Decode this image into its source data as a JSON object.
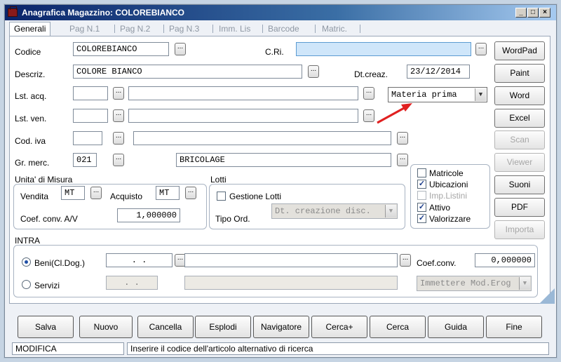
{
  "window": {
    "title": "Anagrafica Magazzino: COLOREBIANCO",
    "controls": {
      "minimize": "_",
      "maximize": "□",
      "close": "×"
    }
  },
  "tabs": [
    "Generali",
    "Pag N.1",
    "Pag N.2",
    "Pag N.3",
    "Imm. Lis",
    "Barcode",
    "Matric."
  ],
  "form": {
    "codice_label": "Codice",
    "codice_value": "COLOREBIANCO",
    "cri_label": "C.Ri.",
    "cri_value": "",
    "descriz_label": "Descriz.",
    "descriz_value": "COLORE BIANCO",
    "dtcreaz_label": "Dt.creaz.",
    "dtcreaz_value": "23/12/2014",
    "lstacq_label": "Lst. acq.",
    "lstacq_code": "",
    "lstacq_desc": "",
    "lstven_label": "Lst. ven.",
    "lstven_code": "",
    "lstven_desc": "",
    "tipo_combo_value": "Materia prima",
    "codiva_label": "Cod. iva",
    "codiva_code": "",
    "codiva_desc": "",
    "grmerc_label": "Gr. merc.",
    "grmerc_code": "021",
    "grmerc_desc": "BRICOLAGE",
    "dots": "..."
  },
  "um": {
    "title": "Unita' di Misura",
    "vendita_label": "Vendita",
    "vendita_value": "MT",
    "acquisto_label": "Acquisto",
    "acquisto_value": "MT",
    "coef_label": "Coef. conv. A/V",
    "coef_value": "1,000000"
  },
  "lotti": {
    "title": "Lotti",
    "gestione_label": "Gestione Lotti",
    "tipo_ord_label": "Tipo Ord.",
    "tipo_ord_value": "Dt. creazione disc."
  },
  "flags": [
    {
      "label": "Matricole",
      "checked": false,
      "enabled": true
    },
    {
      "label": "Ubicazioni",
      "checked": true,
      "enabled": true
    },
    {
      "label": "Imp.Listini",
      "checked": false,
      "enabled": false
    },
    {
      "label": "Attivo",
      "checked": true,
      "enabled": true
    },
    {
      "label": "Valorizzare",
      "checked": true,
      "enabled": true
    }
  ],
  "intra": {
    "title": "INTRA",
    "beni_label": "Beni(Cl.Dog.)",
    "beni_code": ". .",
    "beni_desc": "",
    "servizi_label": "Servizi",
    "servizi_code": ". .",
    "servizi_desc": "",
    "coef_label": "Coef.conv.",
    "coef_value": "0,000000",
    "mod_erog_value": "Immettere Mod.Erog"
  },
  "side_buttons": [
    {
      "label": "WordPad",
      "enabled": true
    },
    {
      "label": "Paint",
      "enabled": true
    },
    {
      "label": "Word",
      "enabled": true
    },
    {
      "label": "Excel",
      "enabled": true
    },
    {
      "label": "Scan",
      "enabled": false
    },
    {
      "label": "Viewer",
      "enabled": false
    },
    {
      "label": "Suoni",
      "enabled": true
    },
    {
      "label": "PDF",
      "enabled": true
    },
    {
      "label": "Importa",
      "enabled": false
    }
  ],
  "bottom_buttons": [
    "Salva",
    "Nuovo",
    "Cancella",
    "Esplodi",
    "Navigatore",
    "Cerca+",
    "Cerca",
    "Guida",
    "Fine"
  ],
  "status": {
    "mode": "MODIFICA",
    "message": "Inserire il codice dell'articolo alternativo di ricerca"
  },
  "colors": {
    "annotation_arrow": "#e02020",
    "cri_field": "#cfe6fa"
  }
}
